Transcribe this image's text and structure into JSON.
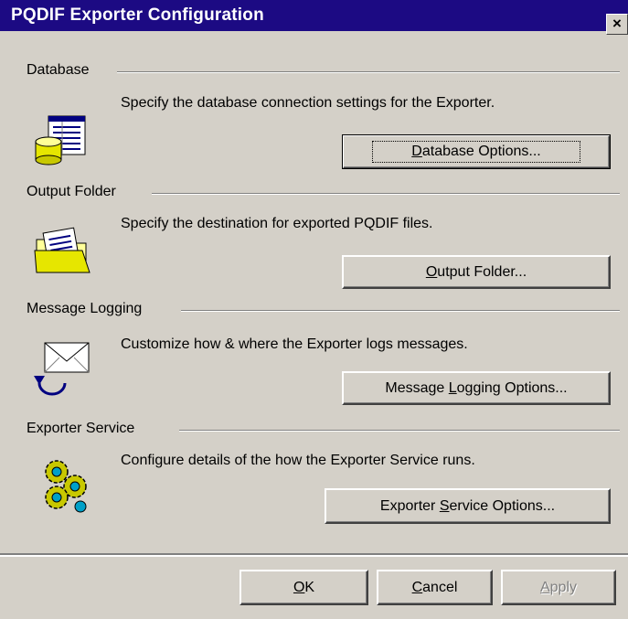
{
  "window": {
    "title": "PQDIF Exporter Configuration",
    "close_label": "×"
  },
  "sections": [
    {
      "label": "Database",
      "description": "Specify the database connection settings for the Exporter.",
      "button": {
        "pre": "",
        "accel": "D",
        "post": "atabase Options..."
      },
      "icon": "database-icon"
    },
    {
      "label": "Output Folder",
      "description": "Specify the destination for exported PQDIF files.",
      "button": {
        "pre": "",
        "accel": "O",
        "post": "utput Folder..."
      },
      "icon": "folder-icon"
    },
    {
      "label": "Message Logging",
      "description": "Customize how & where the Exporter logs messages.",
      "button": {
        "pre": "Message ",
        "accel": "L",
        "post": "ogging Options..."
      },
      "icon": "envelope-icon"
    },
    {
      "label": "Exporter Service",
      "description": "Configure details of the how the Exporter Service runs.",
      "button": {
        "pre": "Exporter ",
        "accel": "S",
        "post": "ervice Options..."
      },
      "icon": "gears-icon"
    }
  ],
  "footer": {
    "ok": {
      "accel": "O",
      "post": "K"
    },
    "cancel": {
      "accel": "C",
      "post": "ancel"
    },
    "apply": {
      "accel": "A",
      "post": "pply"
    }
  }
}
